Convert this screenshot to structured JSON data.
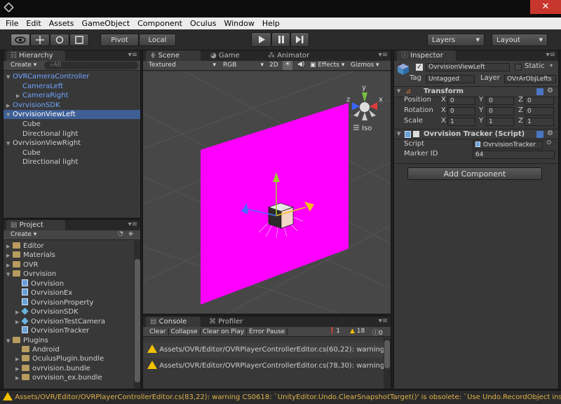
{
  "window": {
    "close_glyph": "✕"
  },
  "menu": [
    "File",
    "Edit",
    "Assets",
    "GameObject",
    "Component",
    "Oculus",
    "Window",
    "Help"
  ],
  "toolbar": {
    "pivot": "Pivot",
    "local": "Local",
    "layers": "Layers",
    "layout": "Layout",
    "play_icon": "play-icon",
    "pause_icon": "pause-icon",
    "step_icon": "step-icon"
  },
  "hierarchy": {
    "tab": "Hierarchy",
    "create": "Create",
    "search_placeholder": "All",
    "items": [
      {
        "label": "OVRCameraController",
        "indent": 0,
        "arrow": "▼",
        "style": "blue"
      },
      {
        "label": "CameraLeft",
        "indent": 1,
        "arrow": "",
        "style": "blue"
      },
      {
        "label": "CameraRight",
        "indent": 1,
        "arrow": "▶",
        "style": "blue"
      },
      {
        "label": "OvrvisionSDK",
        "indent": 0,
        "arrow": "▶",
        "style": "blue"
      },
      {
        "label": "OvrvisionViewLeft",
        "indent": 0,
        "arrow": "▼",
        "style": "sel"
      },
      {
        "label": "Cube",
        "indent": 1,
        "arrow": "",
        "style": ""
      },
      {
        "label": "Directional light",
        "indent": 1,
        "arrow": "",
        "style": ""
      },
      {
        "label": "OvrvisionViewRight",
        "indent": 0,
        "arrow": "▼",
        "style": ""
      },
      {
        "label": "Cube",
        "indent": 1,
        "arrow": "",
        "style": ""
      },
      {
        "label": "Directional light",
        "indent": 1,
        "arrow": "",
        "style": ""
      }
    ]
  },
  "scene": {
    "tabs": [
      "Scene",
      "Game",
      "Animator"
    ],
    "shading": "Textured",
    "render_mode": "RGB",
    "mode_2d": "2D",
    "effects": "Effects",
    "gizmos": "Gizmos",
    "search_placeholder": "All",
    "gizmo_y": "y",
    "gizmo_z": "z",
    "gizmo_x": "x",
    "projection": "Iso",
    "plane_color": "#ff00ff"
  },
  "inspector": {
    "tab": "Inspector",
    "object_name": "OvrvisionViewLeft",
    "static_label": "Static",
    "tag_label": "Tag",
    "tag_value": "Untagged",
    "layer_label": "Layer",
    "layer_value": "OVrArObjLefts",
    "transform_title": "Transform",
    "position_label": "Position",
    "rotation_label": "Rotation",
    "scale_label": "Scale",
    "position": {
      "x": "0",
      "y": "0",
      "z": "0"
    },
    "rotation": {
      "x": "0",
      "y": "0",
      "z": "0"
    },
    "scale": {
      "x": "1",
      "y": "1",
      "z": "1"
    },
    "axis_x": "X",
    "axis_y": "Y",
    "axis_z": "Z",
    "tracker_title": "Ovrvision Tracker (Script)",
    "script_label": "Script",
    "script_value": "OvrvisionTracker",
    "marker_label": "Marker ID",
    "marker_value": "64",
    "add_component": "Add Component"
  },
  "project": {
    "tab": "Project",
    "create": "Create",
    "items": [
      {
        "label": "Editor",
        "indent": 0,
        "arrow": "▶",
        "icon": "folder"
      },
      {
        "label": "Materials",
        "indent": 0,
        "arrow": "▶",
        "icon": "folder"
      },
      {
        "label": "OVR",
        "indent": 0,
        "arrow": "▶",
        "icon": "folder"
      },
      {
        "label": "Ovrvision",
        "indent": 0,
        "arrow": "▼",
        "icon": "folder"
      },
      {
        "label": "Ovrvision",
        "indent": 1,
        "arrow": "",
        "icon": "script"
      },
      {
        "label": "OvrvisionEx",
        "indent": 1,
        "arrow": "",
        "icon": "script"
      },
      {
        "label": "OvrvisionProperty",
        "indent": 1,
        "arrow": "",
        "icon": "script"
      },
      {
        "label": "OvrvisionSDK",
        "indent": 1,
        "arrow": "▶",
        "icon": "prefab"
      },
      {
        "label": "OvrvisionTestCamera",
        "indent": 1,
        "arrow": "▶",
        "icon": "prefab"
      },
      {
        "label": "OvrvisionTracker",
        "indent": 1,
        "arrow": "",
        "icon": "script"
      },
      {
        "label": "Plugins",
        "indent": 0,
        "arrow": "▼",
        "icon": "folder"
      },
      {
        "label": "Android",
        "indent": 1,
        "arrow": "",
        "icon": "folder"
      },
      {
        "label": "OculusPlugin.bundle",
        "indent": 1,
        "arrow": "▶",
        "icon": "folder"
      },
      {
        "label": "ovrvision.bundle",
        "indent": 1,
        "arrow": "▶",
        "icon": "folder"
      },
      {
        "label": "ovrvision_ex.bundle",
        "indent": 1,
        "arrow": "▶",
        "icon": "folder"
      }
    ]
  },
  "console": {
    "tabs": [
      "Console",
      "Profiler"
    ],
    "buttons": [
      "Clear",
      "Collapse",
      "Clear on Play",
      "Error Pause"
    ],
    "counts": {
      "errors": "1",
      "warnings": "18",
      "messages": "0"
    },
    "messages": [
      "Assets/OVR/Editor/OVRPlayerControllerEditor.cs(60,22): warning",
      "Assets/OVR/Editor/OVRPlayerControllerEditor.cs(78,30): warning"
    ]
  },
  "status": {
    "message": "Assets/OVR/Editor/OVRPlayerControllerEditor.cs(83,22): warning CS0618: `UnityEditor.Undo.ClearSnapshotTarget()' is obsolete: `Use Undo.RecordObject inste"
  }
}
